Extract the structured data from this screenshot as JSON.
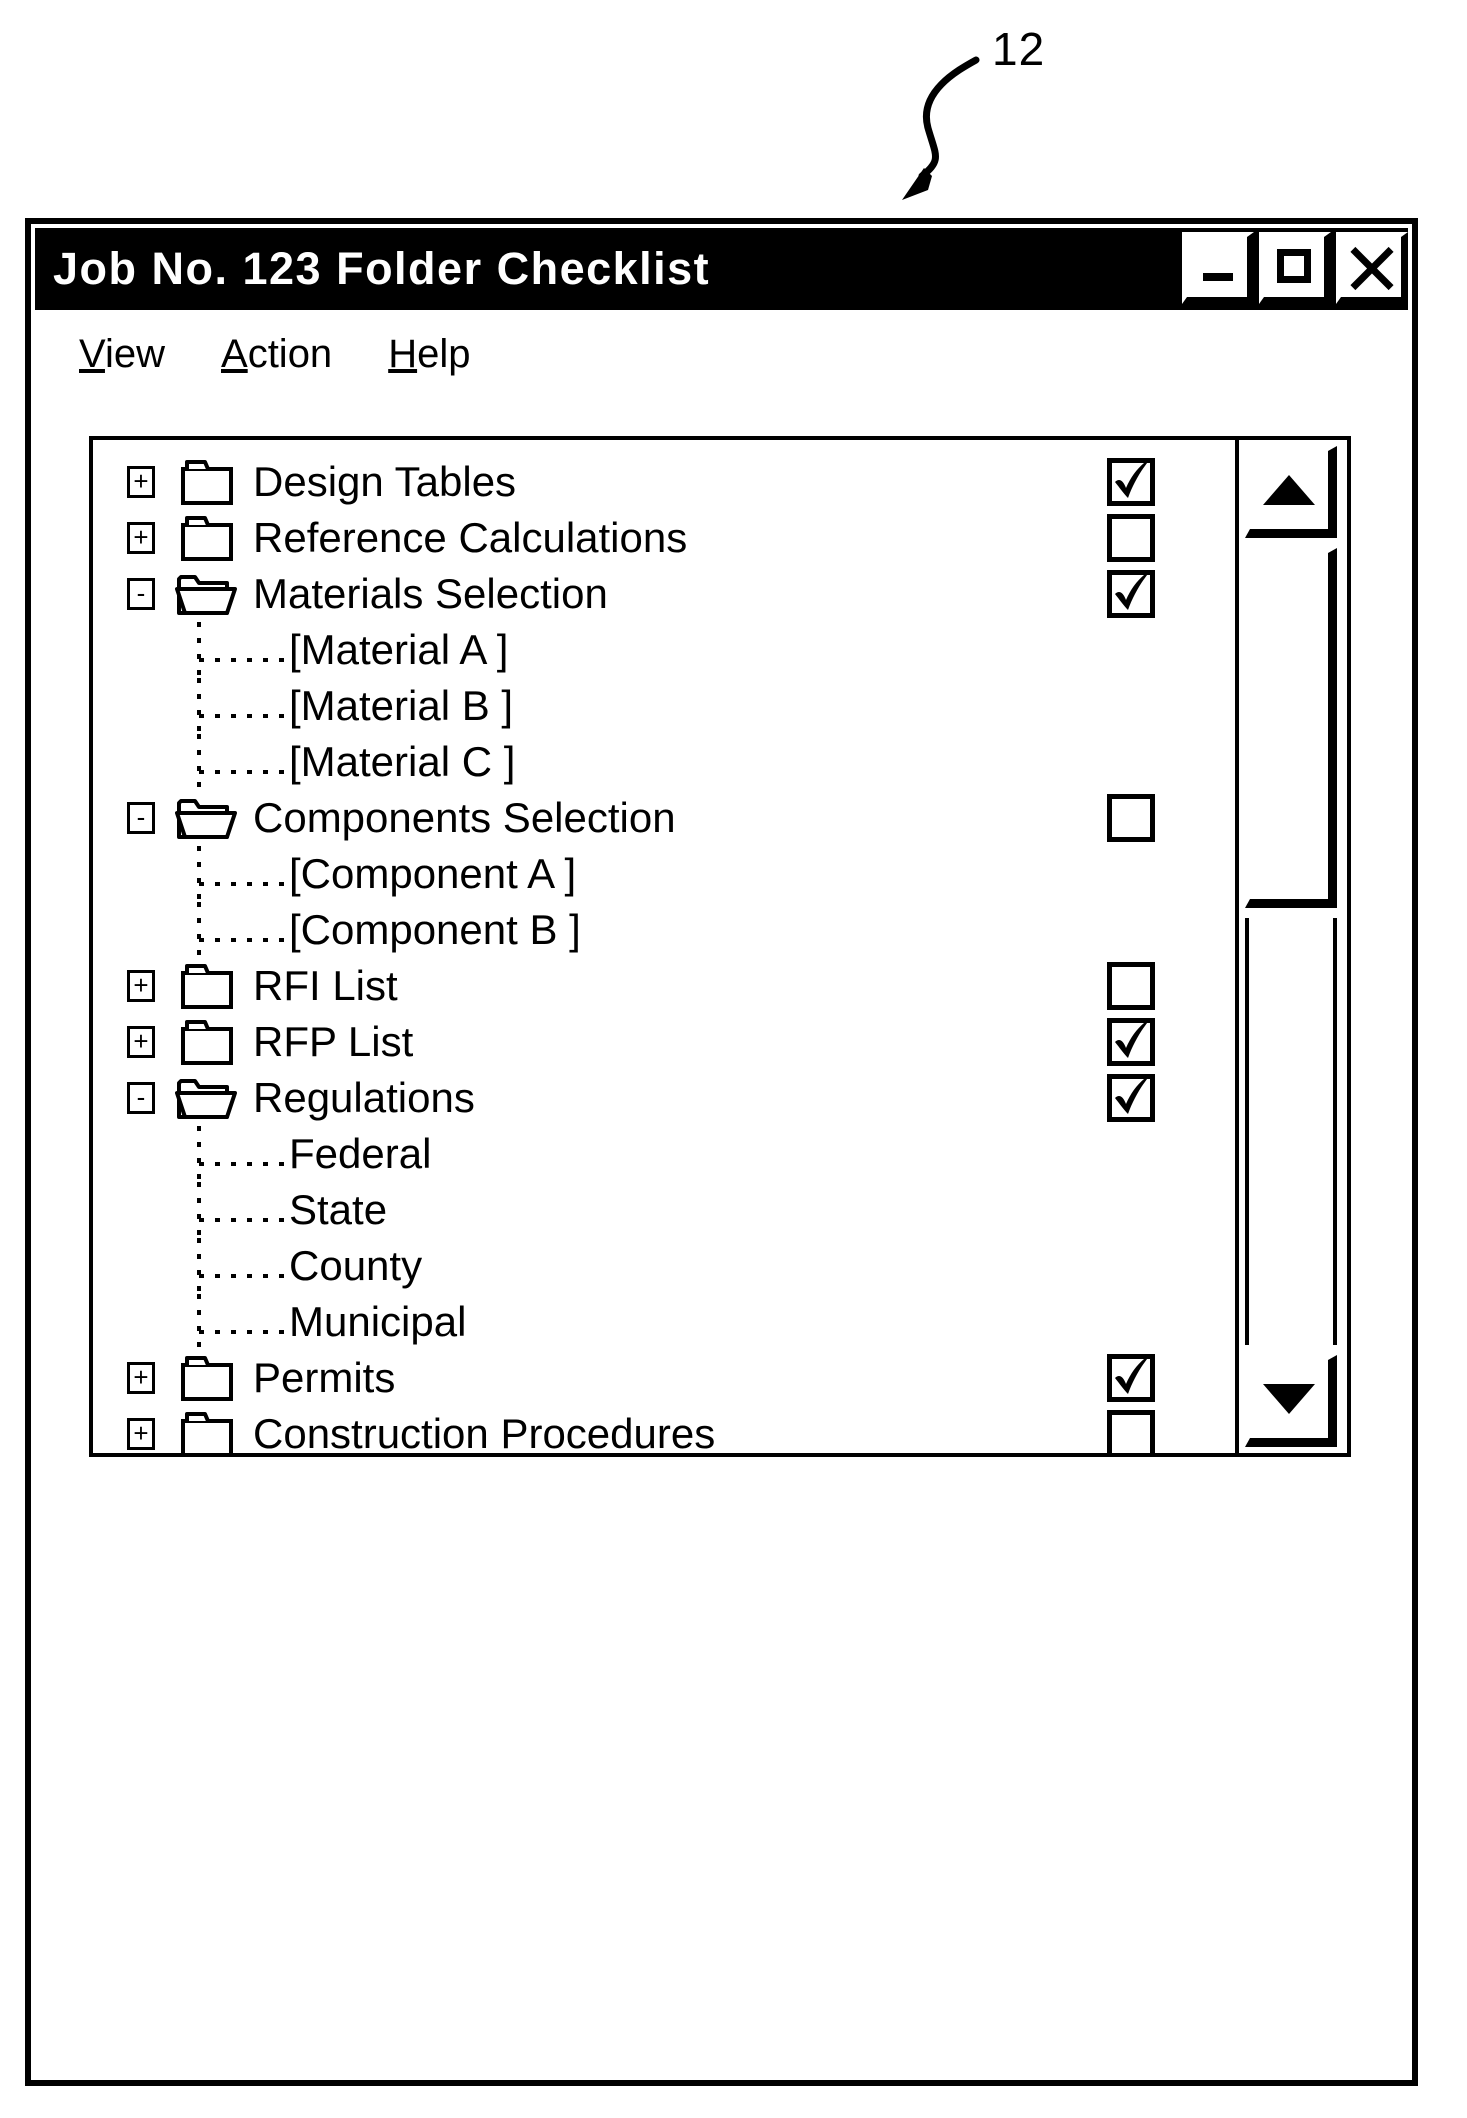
{
  "figure": {
    "reference_numeral": "12",
    "arrow": "curved-arrow-pointing-down-left"
  },
  "window": {
    "title": "Job No. 123 Folder Checklist",
    "controls": [
      {
        "name": "minimize-button",
        "glyph": "minimize-icon",
        "label": "—"
      },
      {
        "name": "maximize-button",
        "glyph": "maximize-icon",
        "label": "□"
      },
      {
        "name": "close-button",
        "glyph": "close-icon",
        "label": "✕"
      }
    ]
  },
  "menubar": {
    "items": [
      {
        "label": "View",
        "mnemonic": "V",
        "rest": "iew"
      },
      {
        "label": "Action",
        "mnemonic": "A",
        "rest": "ction"
      },
      {
        "label": "Help",
        "mnemonic": "H",
        "rest": "elp"
      }
    ]
  },
  "tree": {
    "rows": [
      {
        "label": "Design Tables",
        "type": "folder",
        "expander": "+",
        "folder": "closed",
        "checkbox": true,
        "checked": true,
        "indent": 0
      },
      {
        "label": "Reference Calculations",
        "type": "folder",
        "expander": "+",
        "folder": "closed",
        "checkbox": true,
        "checked": false,
        "indent": 0
      },
      {
        "label": "Materials Selection",
        "type": "folder",
        "expander": "-",
        "folder": "open",
        "checkbox": true,
        "checked": true,
        "indent": 0
      },
      {
        "label": "[Material A ]",
        "type": "leaf",
        "expander": "",
        "folder": "none",
        "checkbox": false,
        "checked": false,
        "indent": 1
      },
      {
        "label": "[Material B ]",
        "type": "leaf",
        "expander": "",
        "folder": "none",
        "checkbox": false,
        "checked": false,
        "indent": 1
      },
      {
        "label": "[Material C ]",
        "type": "leaf",
        "expander": "",
        "folder": "none",
        "checkbox": false,
        "checked": false,
        "indent": 1
      },
      {
        "label": "Components Selection",
        "type": "folder",
        "expander": "-",
        "folder": "open",
        "checkbox": true,
        "checked": false,
        "indent": 0
      },
      {
        "label": "[Component A ]",
        "type": "leaf",
        "expander": "",
        "folder": "none",
        "checkbox": false,
        "checked": false,
        "indent": 1
      },
      {
        "label": "[Component B ]",
        "type": "leaf",
        "expander": "",
        "folder": "none",
        "checkbox": false,
        "checked": false,
        "indent": 1
      },
      {
        "label": "RFI List",
        "type": "folder",
        "expander": "+",
        "folder": "closed",
        "checkbox": true,
        "checked": false,
        "indent": 0
      },
      {
        "label": "RFP List",
        "type": "folder",
        "expander": "+",
        "folder": "closed",
        "checkbox": true,
        "checked": true,
        "indent": 0
      },
      {
        "label": "Regulations",
        "type": "folder",
        "expander": "-",
        "folder": "open",
        "checkbox": true,
        "checked": true,
        "indent": 0
      },
      {
        "label": "Federal",
        "type": "leaf",
        "expander": "",
        "folder": "none",
        "checkbox": false,
        "checked": false,
        "indent": 1
      },
      {
        "label": "State",
        "type": "leaf",
        "expander": "",
        "folder": "none",
        "checkbox": false,
        "checked": false,
        "indent": 1
      },
      {
        "label": "County",
        "type": "leaf",
        "expander": "",
        "folder": "none",
        "checkbox": false,
        "checked": false,
        "indent": 1
      },
      {
        "label": "Municipal",
        "type": "leaf",
        "expander": "",
        "folder": "none",
        "checkbox": false,
        "checked": false,
        "indent": 1
      },
      {
        "label": "Permits",
        "type": "folder",
        "expander": "+",
        "folder": "closed",
        "checkbox": true,
        "checked": true,
        "indent": 0
      },
      {
        "label": "Construction Procedures",
        "type": "folder",
        "expander": "+",
        "folder": "closed",
        "checkbox": true,
        "checked": false,
        "indent": 0
      }
    ]
  },
  "scrollbar": {
    "up_arrow": "▲",
    "down_arrow": "▼",
    "orientation": "vertical"
  },
  "colors": {
    "ink": "#000000",
    "paper": "#ffffff"
  }
}
